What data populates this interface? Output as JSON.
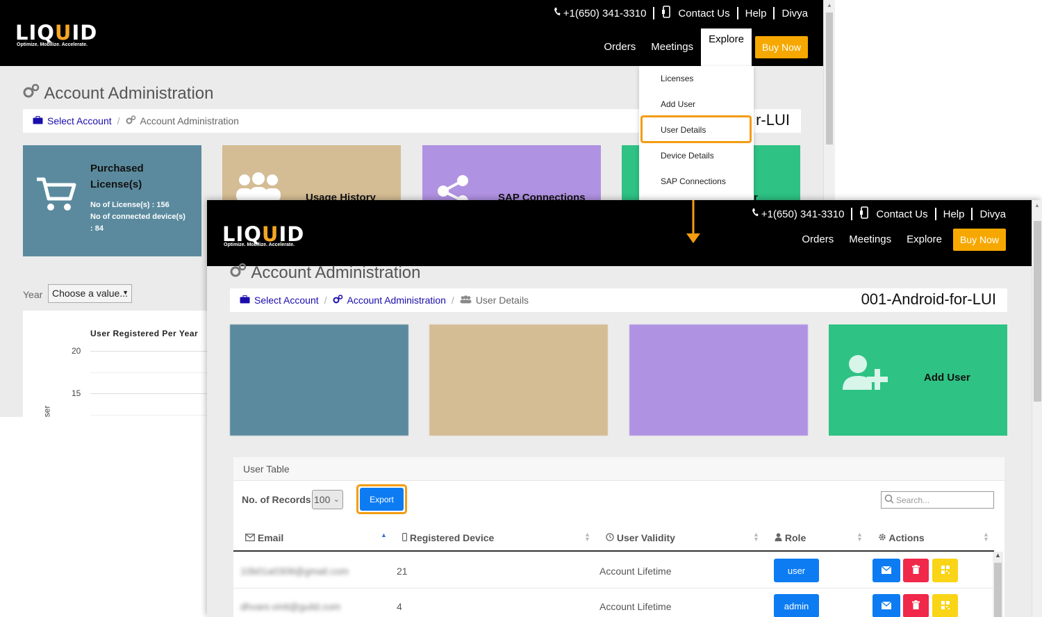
{
  "header": {
    "logo": "LIQUID",
    "tagline": "Optimize. Mobilize. Accelerate.",
    "phone": "+1(650) 341-3310",
    "contact": "Contact Us",
    "help": "Help",
    "user": "Divya",
    "nav": [
      "Orders",
      "Meetings",
      "Explore"
    ],
    "buy_now": "Buy Now"
  },
  "back": {
    "page_title": "Account Administration",
    "breadcrumb": {
      "select_account": "Select Account",
      "current": "Account Administration"
    },
    "account_partial": "r-LUI",
    "tiles": {
      "purchased_title_1": "Purchased",
      "purchased_title_2": "License(s)",
      "licenses_line": "No of License(s) : 156",
      "devices_line": "No of connected device(s)",
      "devices_value": ": 84",
      "usage": "Usage History",
      "sap": "SAP Connections",
      "partial4": "r"
    },
    "year_label": "Year",
    "year_select": "Choose a value...",
    "chart": {
      "title": "User Registered Per Year",
      "ticks": [
        "20",
        "15"
      ],
      "ylabel_partial": "ser"
    },
    "dropdown": [
      "Licenses",
      "Add User",
      "User Details",
      "Device Details",
      "SAP Connections"
    ]
  },
  "front": {
    "page_title": "Account Administration",
    "breadcrumb": {
      "select_account": "Select Account",
      "account_admin": "Account Administration",
      "current": "User Details"
    },
    "account_name": "001-Android-for-LUI",
    "tiles": {
      "add_user": "Add User"
    },
    "table": {
      "title": "User Table",
      "records_label": "No. of Records:",
      "records_value": "100",
      "export": "Export",
      "search_placeholder": "Search...",
      "columns": [
        "Email",
        "Registered Device",
        "User Validity",
        "Role",
        "Actions"
      ],
      "rows": [
        {
          "email": "10b01a0308@gmail.com",
          "devices": "21",
          "validity": "Account Lifetime",
          "role": "user"
        },
        {
          "email": "dhvani.vinit@guild.com",
          "devices": "4",
          "validity": "Account Lifetime",
          "role": "admin"
        }
      ]
    }
  },
  "colors": {
    "tile_blue": "#5b8a9e",
    "tile_tan": "#d4bc94",
    "tile_purple": "#b092e2",
    "tile_green": "#2ec284",
    "accent_orange": "#f39c12",
    "button_blue": "#0d7cf2"
  }
}
